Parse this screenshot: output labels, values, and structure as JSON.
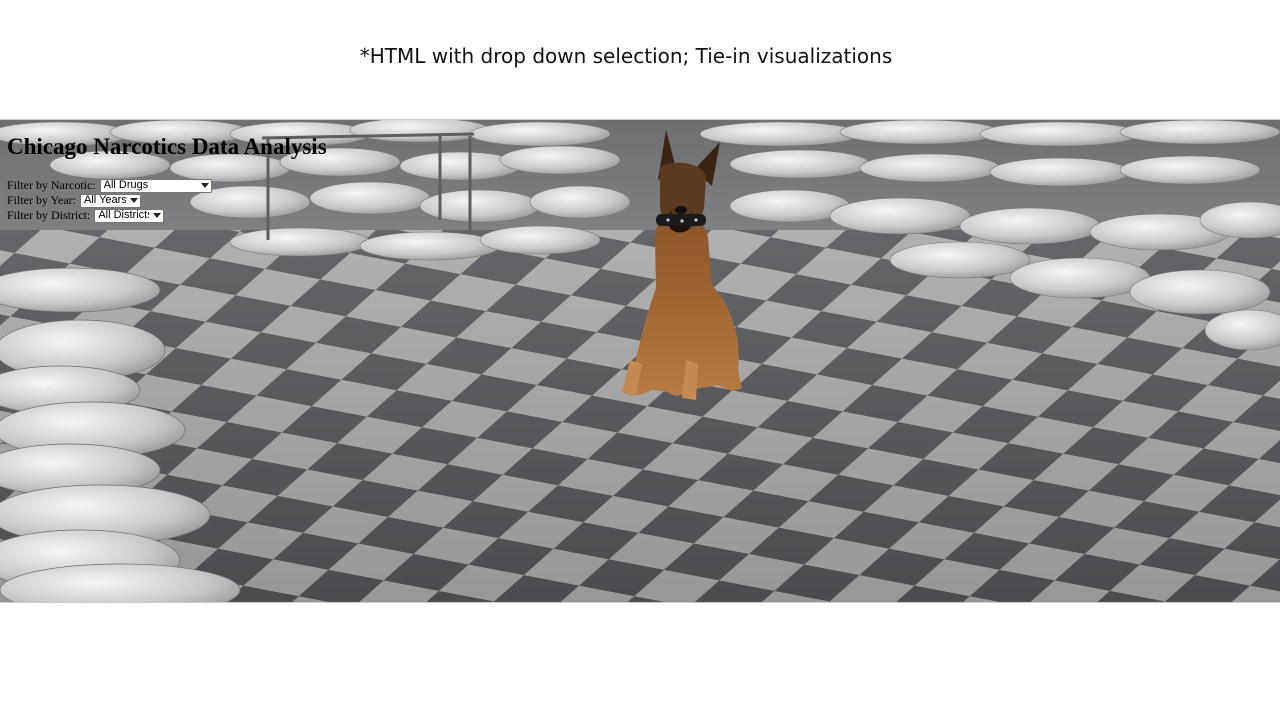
{
  "slide": {
    "caption": "*HTML with drop down selection; Tie-in visualizations"
  },
  "page": {
    "title": "Chicago Narcotics Data Analysis",
    "background_image": "police-dog-seized-narcotics-photo"
  },
  "filters": {
    "narcotic": {
      "label": "Filter by Narcotic:",
      "selected": "All Drugs"
    },
    "year": {
      "label": "Filter by Year:",
      "selected": "All Years"
    },
    "district": {
      "label": "Filter by District:",
      "selected": "All Districts"
    }
  },
  "colors": {
    "floor_light": "#a8a8a8",
    "floor_dark": "#525457",
    "bags": "#d9dadc",
    "dog": "#a86b37"
  }
}
